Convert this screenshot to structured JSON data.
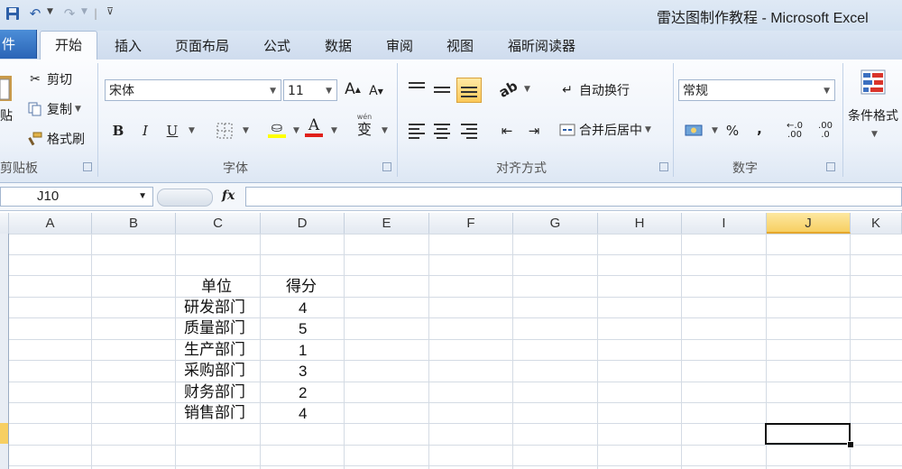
{
  "window": {
    "title": "雷达图制作教程 - Microsoft Excel"
  },
  "quick_access": {
    "icons": [
      "save-icon",
      "undo-icon",
      "redo-icon",
      "customize-icon"
    ]
  },
  "tabs": {
    "file": "件",
    "items": [
      "开始",
      "插入",
      "页面布局",
      "公式",
      "数据",
      "审阅",
      "视图",
      "福昕阅读器"
    ],
    "active": "开始"
  },
  "ribbon": {
    "clipboard": {
      "paste": "贴",
      "cut": "剪切",
      "copy": "复制",
      "format_painter": "格式刷",
      "label": "剪贴板"
    },
    "font": {
      "name": "宋体",
      "size": "11",
      "grow": "A",
      "shrink": "A",
      "bold": "B",
      "italic": "I",
      "underline": "U",
      "font_color": "A",
      "phonetic": "wén",
      "phonetic_char": "变",
      "label": "字体"
    },
    "alignment": {
      "wrap_text": "自动换行",
      "merge_center": "合并后居中",
      "label": "对齐方式"
    },
    "number": {
      "format": "常规",
      "percent": "%",
      "comma": ",",
      "increase_decimal": ".00",
      "decrease_decimal": ".0",
      "label": "数字"
    },
    "styles": {
      "conditional_formatting": "条件格式"
    }
  },
  "formula_bar": {
    "name_box": "J10",
    "fx": "fx",
    "value": ""
  },
  "columns": [
    "A",
    "B",
    "C",
    "D",
    "E",
    "F",
    "G",
    "H",
    "I",
    "J",
    "K"
  ],
  "active_column": "J",
  "sheet": {
    "header": {
      "unit": "单位",
      "score": "得分"
    },
    "rows": [
      {
        "unit": "研发部门",
        "score": "4"
      },
      {
        "unit": "质量部门",
        "score": "5"
      },
      {
        "unit": "生产部门",
        "score": "1"
      },
      {
        "unit": "采购部门",
        "score": "3"
      },
      {
        "unit": "财务部门",
        "score": "2"
      },
      {
        "unit": "销售部门",
        "score": "4"
      }
    ]
  },
  "colors": {
    "file_tab": "#2a64b6",
    "active_header": "#f7cf62",
    "grid_line": "#d4dbe4"
  }
}
